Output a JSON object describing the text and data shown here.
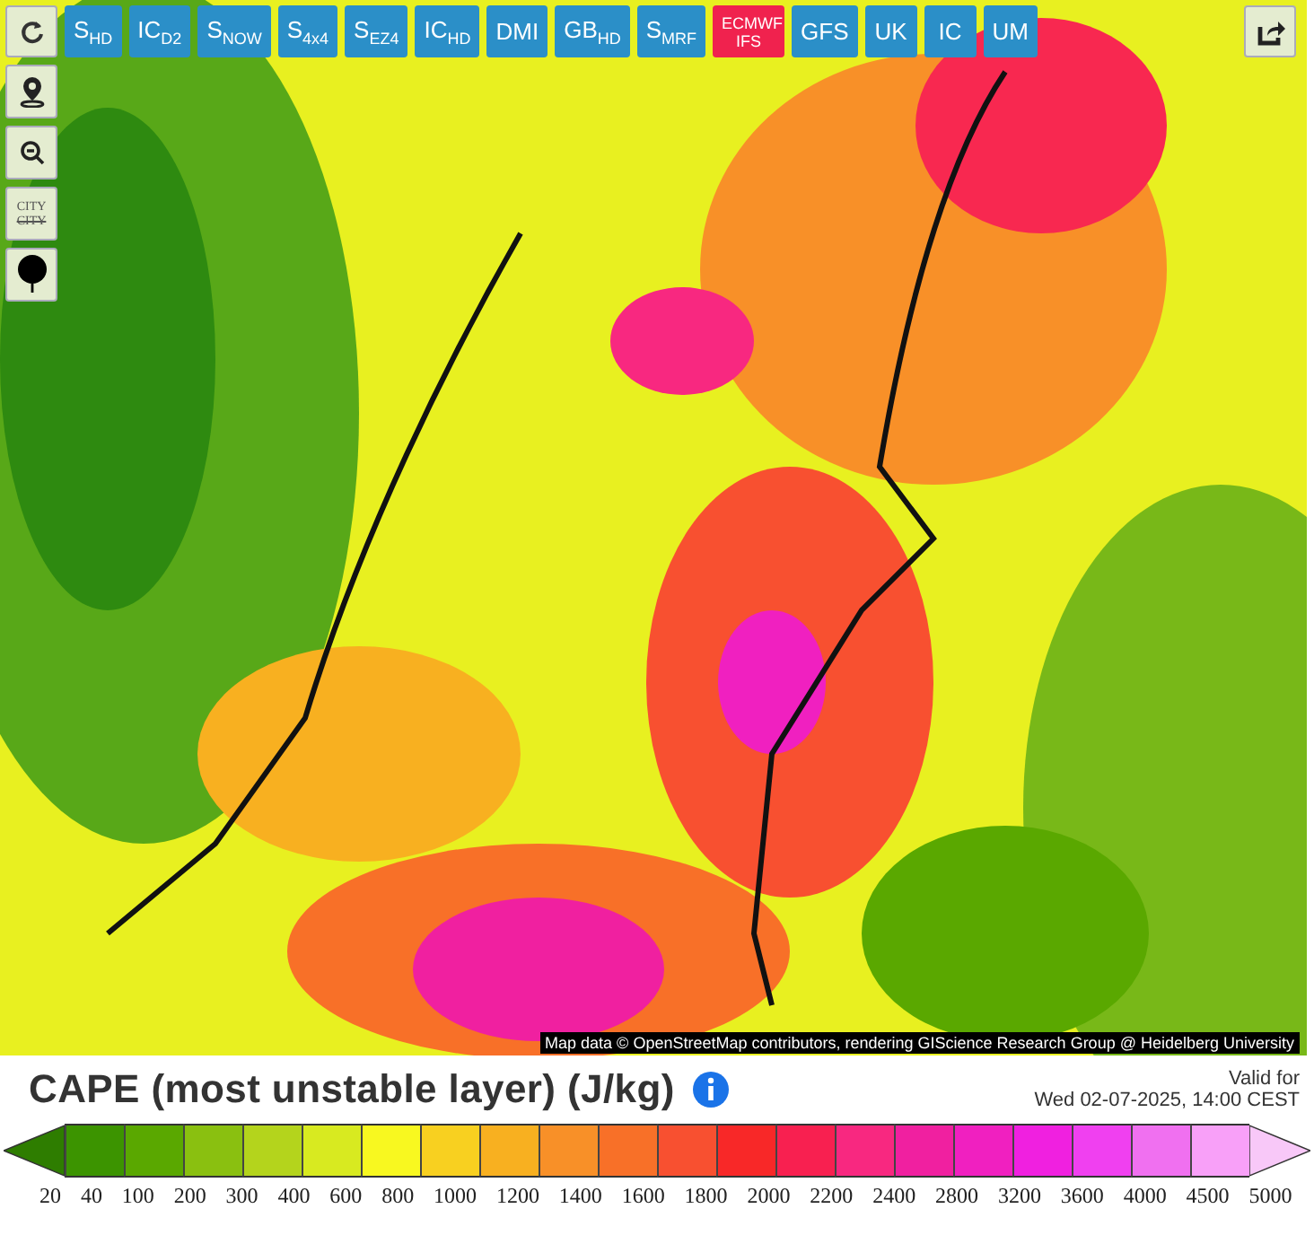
{
  "models": [
    {
      "label": "S$_{HD}$",
      "selected": false
    },
    {
      "label": "IC$_{D2}$",
      "selected": false
    },
    {
      "label": "S$_{NOW}$",
      "selected": false
    },
    {
      "label": "S$_{4x4}$",
      "selected": false
    },
    {
      "label": "S$_{EZ4}$",
      "selected": false
    },
    {
      "label": "IC$_{HD}$",
      "selected": false
    },
    {
      "label": "DMI",
      "selected": false
    },
    {
      "label": "GB$_{HD}$",
      "selected": false
    },
    {
      "label": "S$_{MRF}$",
      "selected": false
    },
    {
      "label": "ECMWF IFS",
      "selected": true
    },
    {
      "label": "GFS",
      "selected": false
    },
    {
      "label": "UK",
      "selected": false
    },
    {
      "label": "IC",
      "selected": false
    },
    {
      "label": "UM",
      "selected": false
    }
  ],
  "city_toggle": {
    "label": "CITY",
    "struck": "CITY"
  },
  "attribution": "Map data © OpenStreetMap contributors, rendering GIScience Research Group @ Heidelberg University",
  "title": "CAPE (most unstable layer) (J/kg)",
  "valid": {
    "label": "Valid for",
    "time": "Wed 02-07-2025, 14:00 CEST"
  },
  "legend": {
    "segments": [
      {
        "kind": "below",
        "color": "#2e7d00"
      },
      {
        "color": "#3c9400"
      },
      {
        "color": "#5aa800"
      },
      {
        "color": "#8ac010"
      },
      {
        "color": "#b4d41c"
      },
      {
        "color": "#d8ea20"
      },
      {
        "color": "#f8f820"
      },
      {
        "color": "#f8d020"
      },
      {
        "color": "#f8b020"
      },
      {
        "color": "#f89028"
      },
      {
        "color": "#f87028"
      },
      {
        "color": "#f85030"
      },
      {
        "color": "#f82828"
      },
      {
        "color": "#f82050"
      },
      {
        "color": "#f82880"
      },
      {
        "color": "#f020a0"
      },
      {
        "color": "#f020c0"
      },
      {
        "color": "#f020e0"
      },
      {
        "color": "#f040f0"
      },
      {
        "color": "#f070f0"
      },
      {
        "color": "#f8a0f8"
      },
      {
        "kind": "above",
        "color": "#f8c8f8"
      }
    ],
    "labels": [
      "20",
      "40",
      "100",
      "200",
      "300",
      "400",
      "600",
      "800",
      "1000",
      "1200",
      "1400",
      "1600",
      "1800",
      "2000",
      "2200",
      "2400",
      "2800",
      "3200",
      "3600",
      "4000",
      "4500",
      "5000"
    ]
  }
}
